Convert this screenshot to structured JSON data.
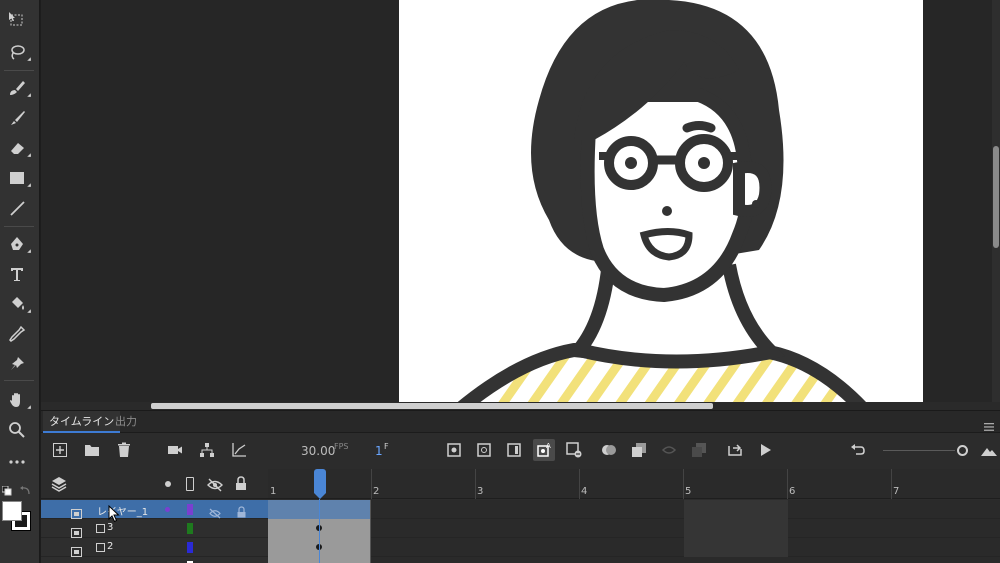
{
  "timeline": {
    "tabs": [
      "タイムライン",
      "出力"
    ],
    "fps": "30.00",
    "fps_unit": "FPS",
    "current_frame": "1",
    "frame_unit": "F",
    "frame_numbers": [
      "1",
      "2",
      "3",
      "4",
      "5",
      "6",
      "7"
    ],
    "layers": [
      {
        "name": "レイヤー_1",
        "color": "#7a3fd0",
        "selected": true
      },
      {
        "name": "3",
        "color": "#1e7a1e",
        "selected": false
      },
      {
        "name": "2",
        "color": "#2a2ad6",
        "selected": false
      }
    ]
  }
}
